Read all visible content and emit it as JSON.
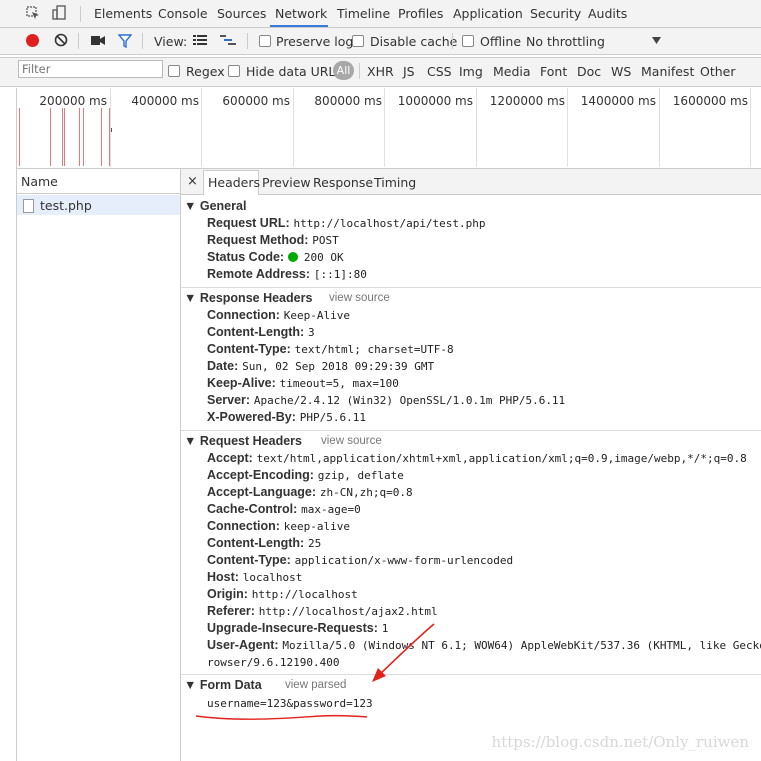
{
  "tabs": [
    "Elements",
    "Console",
    "Sources",
    "Network",
    "Timeline",
    "Profiles",
    "Application",
    "Security",
    "Audits"
  ],
  "active_tab": "Network",
  "toolbar": {
    "view_label": "View:",
    "preserve_log": "Preserve log",
    "disable_cache": "Disable cache",
    "offline": "Offline",
    "throttling": "No throttling"
  },
  "filterbar": {
    "placeholder": "Filter",
    "regex": "Regex",
    "hide_data_urls": "Hide data URLs",
    "all": "All",
    "types": [
      "XHR",
      "JS",
      "CSS",
      "Img",
      "Media",
      "Font",
      "Doc",
      "WS",
      "Manifest",
      "Other"
    ]
  },
  "overview": {
    "ticks": [
      "200000 ms",
      "400000 ms",
      "600000 ms",
      "800000 ms",
      "1000000 ms",
      "1200000 ms",
      "1400000 ms",
      "1600000 ms"
    ]
  },
  "requests": {
    "header": "Name",
    "rows": [
      "test.php"
    ]
  },
  "detail_tabs": [
    "Headers",
    "Preview",
    "Response",
    "Timing"
  ],
  "general": {
    "title": "General",
    "fields": [
      {
        "k": "Request URL:",
        "v": "http://localhost/api/test.php"
      },
      {
        "k": "Request Method:",
        "v": "POST"
      },
      {
        "k": "Status Code:",
        "v": "200 OK"
      },
      {
        "k": "Remote Address:",
        "v": "[::1]:80"
      }
    ]
  },
  "response_headers": {
    "title": "Response Headers",
    "link": "view source",
    "fields": [
      {
        "k": "Connection:",
        "v": "Keep-Alive"
      },
      {
        "k": "Content-Length:",
        "v": "3"
      },
      {
        "k": "Content-Type:",
        "v": "text/html; charset=UTF-8"
      },
      {
        "k": "Date:",
        "v": "Sun, 02 Sep 2018 09:29:39 GMT"
      },
      {
        "k": "Keep-Alive:",
        "v": "timeout=5, max=100"
      },
      {
        "k": "Server:",
        "v": "Apache/2.4.12 (Win32) OpenSSL/1.0.1m PHP/5.6.11"
      },
      {
        "k": "X-Powered-By:",
        "v": "PHP/5.6.11"
      }
    ]
  },
  "request_headers": {
    "title": "Request Headers",
    "link": "view source",
    "fields": [
      {
        "k": "Accept:",
        "v": "text/html,application/xhtml+xml,application/xml;q=0.9,image/webp,*/*;q=0.8"
      },
      {
        "k": "Accept-Encoding:",
        "v": "gzip, deflate"
      },
      {
        "k": "Accept-Language:",
        "v": "zh-CN,zh;q=0.8"
      },
      {
        "k": "Cache-Control:",
        "v": "max-age=0"
      },
      {
        "k": "Connection:",
        "v": "keep-alive"
      },
      {
        "k": "Content-Length:",
        "v": "25"
      },
      {
        "k": "Content-Type:",
        "v": "application/x-www-form-urlencoded"
      },
      {
        "k": "Host:",
        "v": "localhost"
      },
      {
        "k": "Origin:",
        "v": "http://localhost"
      },
      {
        "k": "Referer:",
        "v": "http://localhost/ajax2.html"
      },
      {
        "k": "Upgrade-Insecure-Requests:",
        "v": "1"
      },
      {
        "k": "User-Agent:",
        "v": "Mozilla/5.0 (Windows NT 6.1; WOW64) AppleWebKit/537.36 (KHTML, like Gecko"
      }
    ],
    "wrap": "rowser/9.6.12190.400"
  },
  "form_data": {
    "title": "Form Data",
    "link": "view parsed",
    "value": "username=123&password=123"
  },
  "watermark": "https://blog.csdn.net/Only_ruiwen"
}
